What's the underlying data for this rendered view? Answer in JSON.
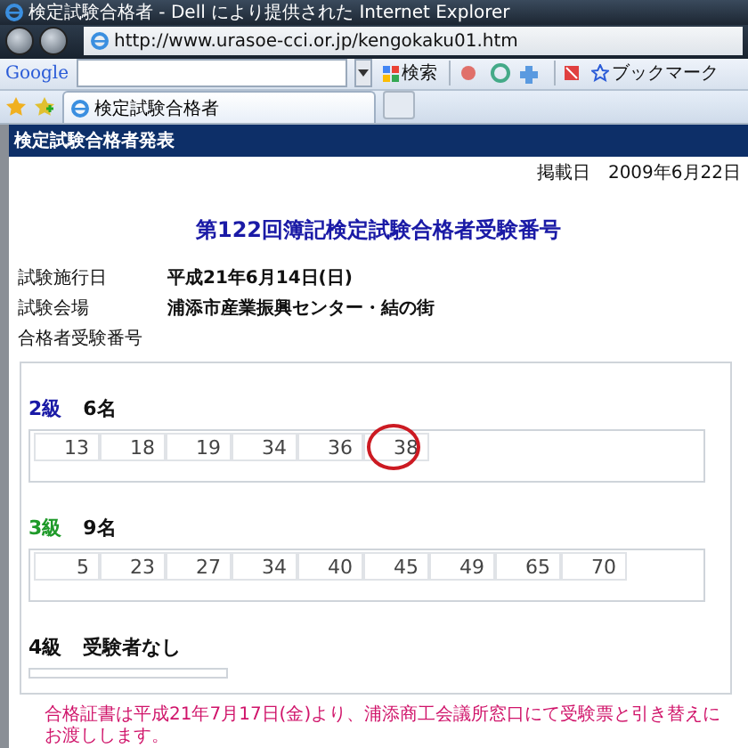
{
  "window": {
    "title": "検定試験合格者 - Dell により提供された Internet Explorer"
  },
  "address_bar": {
    "url": "http://www.urasoe-cci.or.jp/kengokaku01.htm"
  },
  "google_toolbar": {
    "logo": "Google",
    "search_button": "検索",
    "bookmarks_button": "ブックマーク"
  },
  "tabs": [
    {
      "label": "検定試験合格者",
      "selected": true
    }
  ],
  "page": {
    "header": "検定試験合格者発表",
    "posted_label": "掲載日",
    "posted_date": "2009年6月22日",
    "heading": "第122回簿記検定試験合格者受験番号",
    "info": [
      {
        "label": "試験施行日",
        "value": "平成21年6月14日(日)"
      },
      {
        "label": "試験会場",
        "value": "浦添市産業振興センター・結の街"
      },
      {
        "label": "合格者受験番号"
      }
    ],
    "sections": [
      {
        "grade": "2級",
        "count": "6名",
        "color": "#1a1aa6",
        "numbers": [
          {
            "text": "13",
            "circled": false
          },
          {
            "text": "18",
            "circled": false
          },
          {
            "text": "19",
            "circled": false
          },
          {
            "text": "34",
            "circled": false
          },
          {
            "text": "36",
            "circled": false
          },
          {
            "text": "38",
            "circled": true
          }
        ]
      },
      {
        "grade": "3級",
        "count": "9名",
        "color": "#1f9a2a",
        "numbers": [
          {
            "text": "5",
            "circled": false
          },
          {
            "text": "23",
            "circled": false
          },
          {
            "text": "27",
            "circled": false
          },
          {
            "text": "34",
            "circled": false
          },
          {
            "text": "40",
            "circled": false
          },
          {
            "text": "45",
            "circled": false
          },
          {
            "text": "49",
            "circled": false
          },
          {
            "text": "65",
            "circled": false
          },
          {
            "text": "70",
            "circled": false
          }
        ]
      },
      {
        "grade": "4級",
        "count": "受験者なし",
        "color": "#111111"
      }
    ],
    "notice": "合格証書は平成21年7月17日(金)より、浦添商工会議所窓口にて受験票と引き替えにお渡しします。"
  }
}
